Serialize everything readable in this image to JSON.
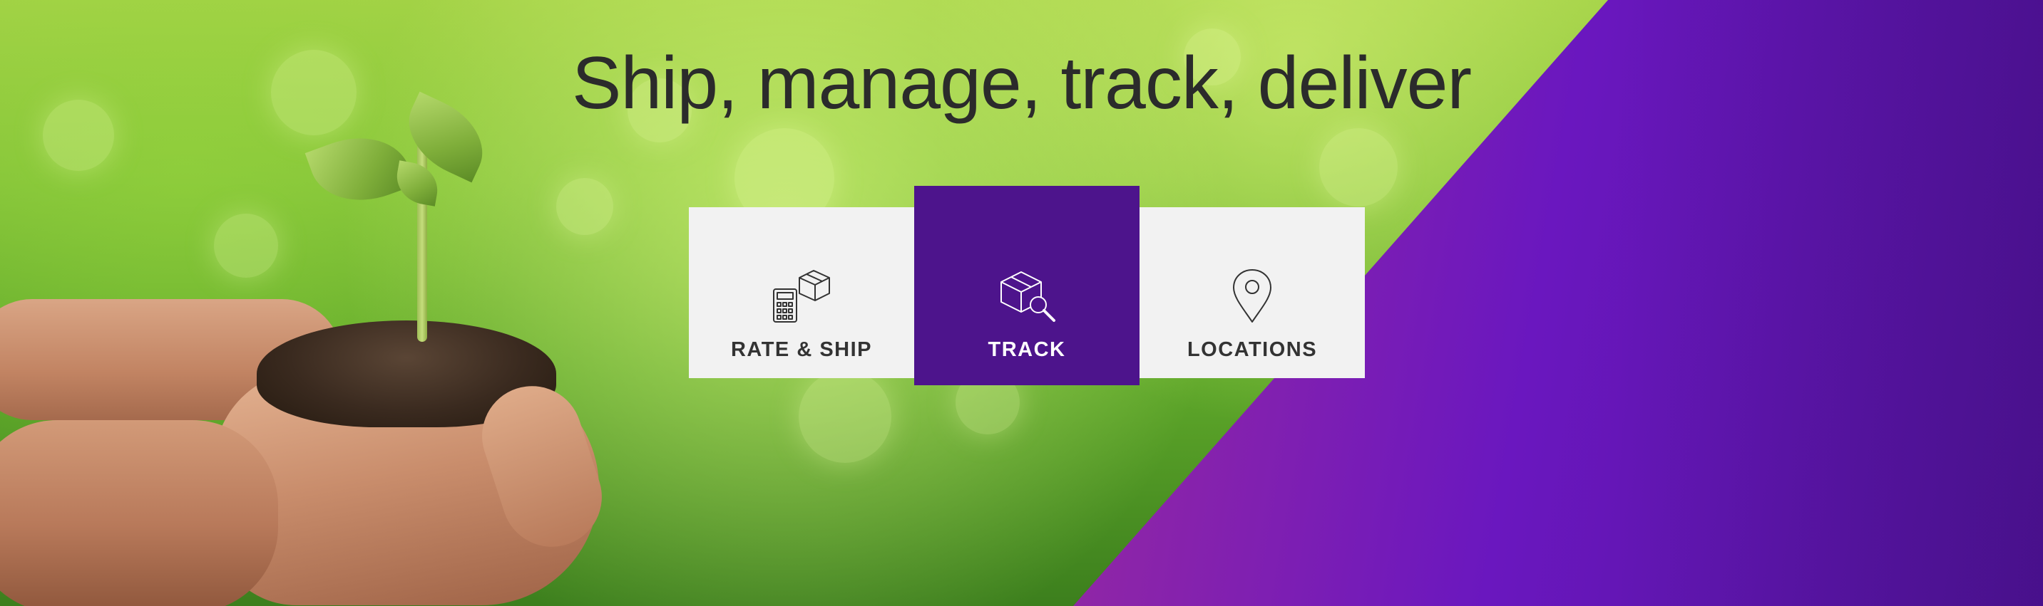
{
  "hero": {
    "headline": "Ship, manage, track, deliver"
  },
  "tiles": [
    {
      "label": "RATE & SHIP",
      "icon": "calculator-box-icon"
    },
    {
      "label": "TRACK",
      "icon": "box-magnifier-icon",
      "active": true
    },
    {
      "label": "LOCATIONS",
      "icon": "map-pin-icon"
    }
  ],
  "colors": {
    "track_tile_bg": "#4d148c",
    "tile_bg": "#f2f2f2",
    "headline_text": "#2b2b2b",
    "gradient_orange": "#f2600c",
    "gradient_purple": "#6a17bf"
  }
}
